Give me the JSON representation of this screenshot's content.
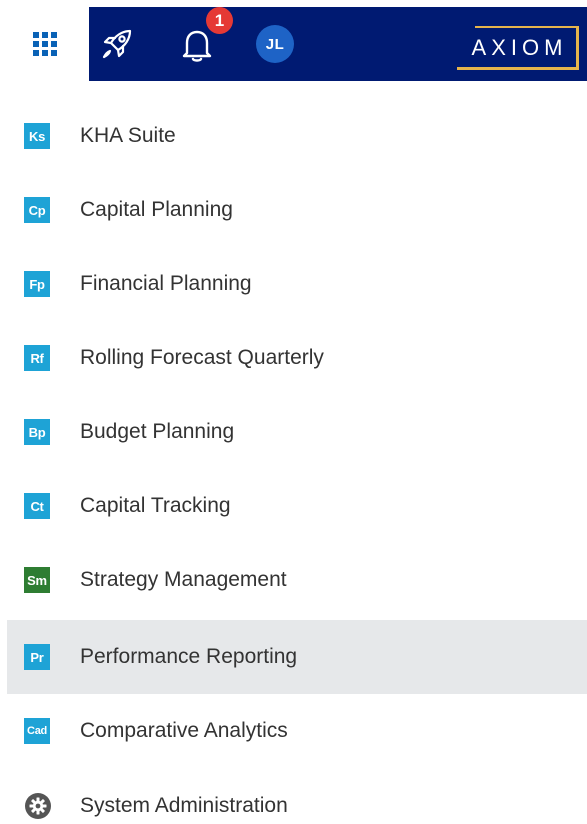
{
  "header": {
    "notification_count": "1",
    "avatar_initials": "JL",
    "logo_text": "AXIOM"
  },
  "menu": {
    "items": [
      {
        "abbr": "Ks",
        "label": "KHA Suite",
        "color": "#1ea3d6"
      },
      {
        "abbr": "Cp",
        "label": "Capital Planning",
        "color": "#1ea3d6"
      },
      {
        "abbr": "Fp",
        "label": "Financial Planning",
        "color": "#1ea3d6"
      },
      {
        "abbr": "Rf",
        "label": "Rolling Forecast Quarterly",
        "color": "#1ea3d6"
      },
      {
        "abbr": "Bp",
        "label": "Budget Planning",
        "color": "#1ea3d6"
      },
      {
        "abbr": "Ct",
        "label": "Capital Tracking",
        "color": "#1ea3d6"
      },
      {
        "abbr": "Sm",
        "label": "Strategy Management",
        "color": "#2e7d32"
      },
      {
        "abbr": "Pr",
        "label": "Performance Reporting",
        "color": "#1ea3d6",
        "selected": true
      },
      {
        "abbr": "Cad",
        "label": "Comparative Analytics",
        "color": "#1ea3d6"
      },
      {
        "abbr": "",
        "label": "System Administration",
        "icon": "gear-icon"
      }
    ]
  },
  "colors": {
    "navy": "#001a72",
    "accent_gold": "#e6b44c",
    "badge_red": "#e53935",
    "avatar_blue": "#1e63c6",
    "selected_bg": "#e6e8ea"
  }
}
